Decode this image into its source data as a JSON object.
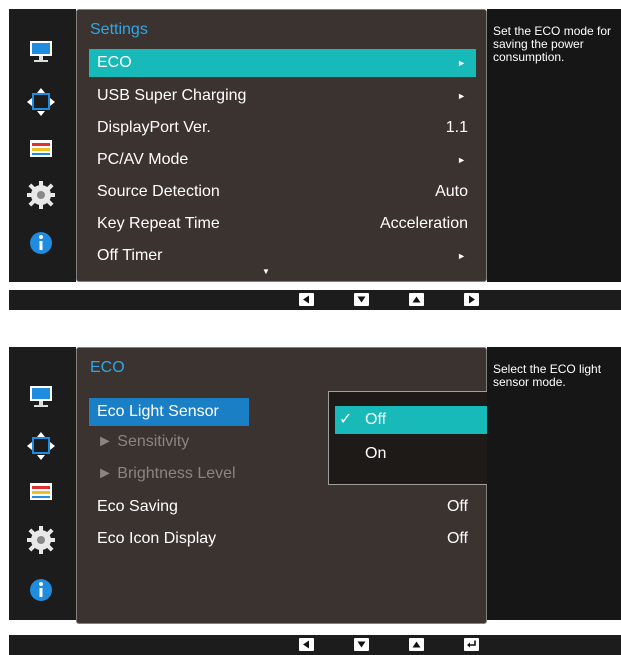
{
  "colors": {
    "accent": "#17b9b9",
    "title": "#2ea8e8",
    "menu_bg": "#3a3330",
    "highlight": "#1a7fc4"
  },
  "icons": [
    "monitor-icon",
    "size-position-icon",
    "color-settings-icon",
    "gear-icon",
    "info-icon"
  ],
  "settings_panel": {
    "title": "Settings",
    "help": "Set the ECO mode for saving the power consumption.",
    "rows": [
      {
        "label": "ECO",
        "value": "",
        "arrow": "►"
      },
      {
        "label": "USB Super Charging",
        "value": "",
        "arrow": "►"
      },
      {
        "label": "DisplayPort Ver.",
        "value": "1.1",
        "arrow": ""
      },
      {
        "label": "PC/AV Mode",
        "value": "",
        "arrow": "►"
      },
      {
        "label": "Source Detection",
        "value": "Auto",
        "arrow": ""
      },
      {
        "label": "Key Repeat Time",
        "value": "Acceleration",
        "arrow": ""
      },
      {
        "label": "Off Timer",
        "value": "",
        "arrow": "►"
      }
    ],
    "scroll_indicator": "▼",
    "nav_buttons": [
      "left-button",
      "down-button",
      "up-button",
      "right-button"
    ]
  },
  "eco_panel": {
    "title": "ECO",
    "help": "Select the ECO light sensor mode.",
    "rows": [
      {
        "label": "Eco Light Sensor",
        "value": ""
      },
      {
        "label": "► Sensitivity",
        "value": ""
      },
      {
        "label": "► Brightness Level",
        "value": ""
      },
      {
        "label": "Eco Saving",
        "value": "Off"
      },
      {
        "label": "Eco Icon Display",
        "value": "Off"
      }
    ],
    "popup": {
      "check": "✓",
      "options": [
        "Off",
        "On"
      ]
    },
    "nav_buttons": [
      "left-button",
      "down-button",
      "up-button",
      "enter-button"
    ]
  }
}
